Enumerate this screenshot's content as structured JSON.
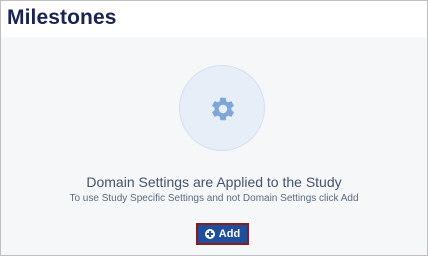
{
  "header": {
    "title": "Milestones"
  },
  "empty_state": {
    "icon": "gear-icon",
    "heading": "Domain Settings are Applied to the Study",
    "subtext": "To use Study Specific Settings and not Domain Settings click Add",
    "add_label": "Add",
    "add_icon": "plus-circle-icon"
  },
  "colors": {
    "title": "#1a2352",
    "button_bg": "#1f4e9c",
    "button_border": "#8b1c1c",
    "circle_bg": "#e6eef8",
    "gear": "#7ea6d6"
  }
}
